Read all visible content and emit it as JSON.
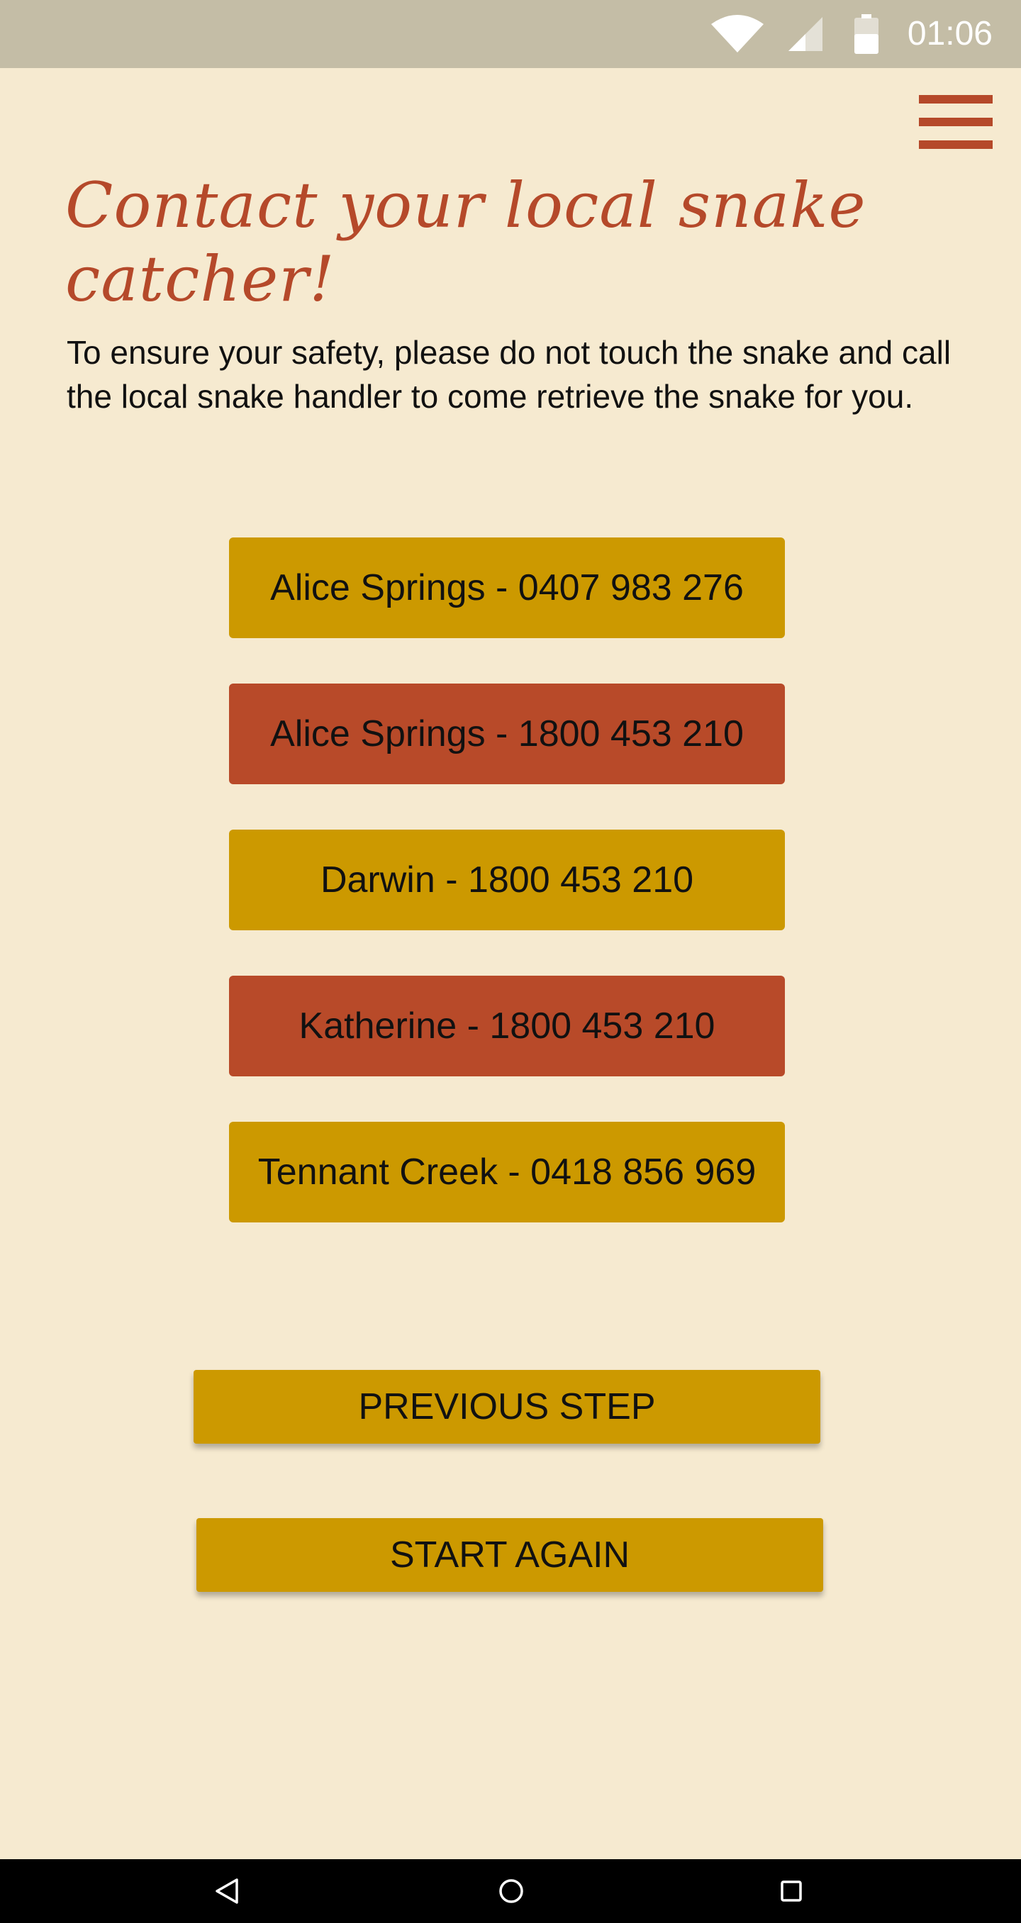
{
  "status_bar": {
    "time": "01:06",
    "icons": [
      "wifi-icon",
      "cell-signal-icon",
      "battery-icon"
    ]
  },
  "header": {
    "menu_icon": "hamburger-menu-icon"
  },
  "main": {
    "title": "Contact your local snake catcher!",
    "intro": "To ensure your safety, please do not touch the snake and call the local snake handler to come retrieve the snake for you.",
    "contacts": [
      {
        "label": "Alice Springs - 0407 983 276",
        "color": "#cc9900"
      },
      {
        "label": "Alice Springs - 1800 453 210",
        "color": "#b84a29"
      },
      {
        "label": "Darwin - 1800 453 210",
        "color": "#cc9900"
      },
      {
        "label": "Katherine - 1800 453 210",
        "color": "#b84a29"
      },
      {
        "label": "Tennant Creek - 0418 856 969",
        "color": "#cc9900"
      }
    ],
    "previous_label": "PREVIOUS STEP",
    "restart_label": "START AGAIN"
  },
  "nav_bar": {
    "icons": [
      "back-icon",
      "home-icon",
      "recents-icon"
    ]
  },
  "colors": {
    "background": "#f6ead0",
    "accent_rust": "#b5492a",
    "accent_gold": "#cc9900",
    "status_bar": "#c4bda6"
  }
}
